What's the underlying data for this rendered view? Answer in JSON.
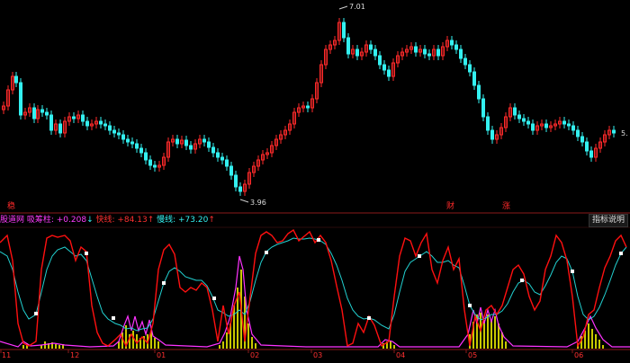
{
  "colors": {
    "up": "#ff2a2a",
    "down": "#33f0f0",
    "panel_line": "#8a1a1a",
    "fast_line": "#ff1010",
    "slow_line": "#22d0d0",
    "pulse": "#ff33ff",
    "bars": "#c8c800",
    "label_white": "#ffffff"
  },
  "main": {
    "high_label": "7.01",
    "low_label": "3.96",
    "last_label": "5.",
    "marks": [
      "稳",
      "财",
      "涨"
    ]
  },
  "indicator": {
    "legend": [
      {
        "text": "股道网 吸筹柱: ",
        "color": "#ff3cff"
      },
      {
        "text": "+0.208",
        "color": "#ff3cff"
      },
      {
        "text": "↓",
        "color": "#33f0f0"
      },
      {
        "text": " 快线: ",
        "color": "#ff3030"
      },
      {
        "text": "+84.13",
        "color": "#ff3030"
      },
      {
        "text": "↑",
        "color": "#ff3030"
      },
      {
        "text": " 慢线: ",
        "color": "#33f0f0"
      },
      {
        "text": "+73.20",
        "color": "#33f0f0"
      },
      {
        "text": "↑",
        "color": "#ff3030"
      }
    ],
    "help_button": "指标说明"
  },
  "x_axis": {
    "labels": [
      "11",
      "12",
      "01",
      "02",
      "03",
      "04",
      "05",
      "06"
    ]
  }
}
